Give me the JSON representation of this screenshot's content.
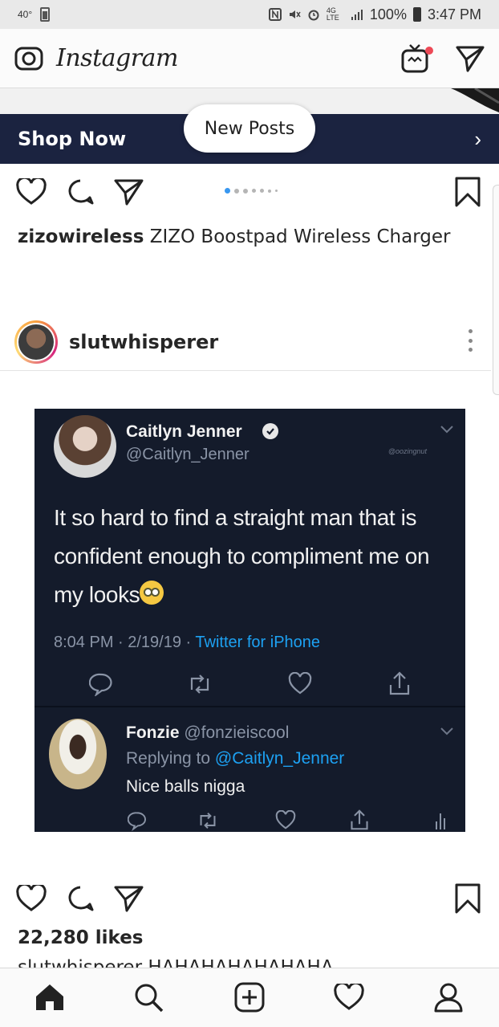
{
  "status_bar": {
    "temperature": "40°",
    "battery_small_label": "100",
    "network_label": "4G LTE",
    "battery_percent": "100%",
    "time": "3:47 PM"
  },
  "header": {
    "app_name": "Instagram",
    "notification_dot_color": "#ed4956"
  },
  "ad": {
    "shop_label": "Shop Now",
    "bar_color": "#1b2340",
    "chevron": "›"
  },
  "new_posts_pill": "New Posts",
  "post1": {
    "carousel_dots": 7,
    "active_dot_color": "#3897f0",
    "caption_user": "zizowireless",
    "caption_text": "ZIZO Boostpad Wireless Charger"
  },
  "post2": {
    "username": "slutwhisperer",
    "tweet1": {
      "name": "Caitlyn Jenner",
      "handle": "@Caitlyn_Jenner",
      "watermark": "@oozingnut",
      "text": "It so hard to find a straight man that is confident enough to compliment me on my looks",
      "meta_time": "8:04 PM · 2/19/19 · ",
      "meta_source": "Twitter for iPhone"
    },
    "tweet2": {
      "name": "Fonzie",
      "handle": "@fonzieiscool",
      "replying_label": "Replying to ",
      "replying_handle": "@Caitlyn_Jenner",
      "text": "Nice balls nigga"
    },
    "likes": "22,280 likes",
    "caption_partial": "slutwhisperer HAHAHAHAHAHAHA"
  },
  "bottom_nav": {
    "items": [
      "home-icon",
      "search-icon",
      "add-post-icon",
      "activity-heart-icon",
      "profile-icon"
    ]
  }
}
